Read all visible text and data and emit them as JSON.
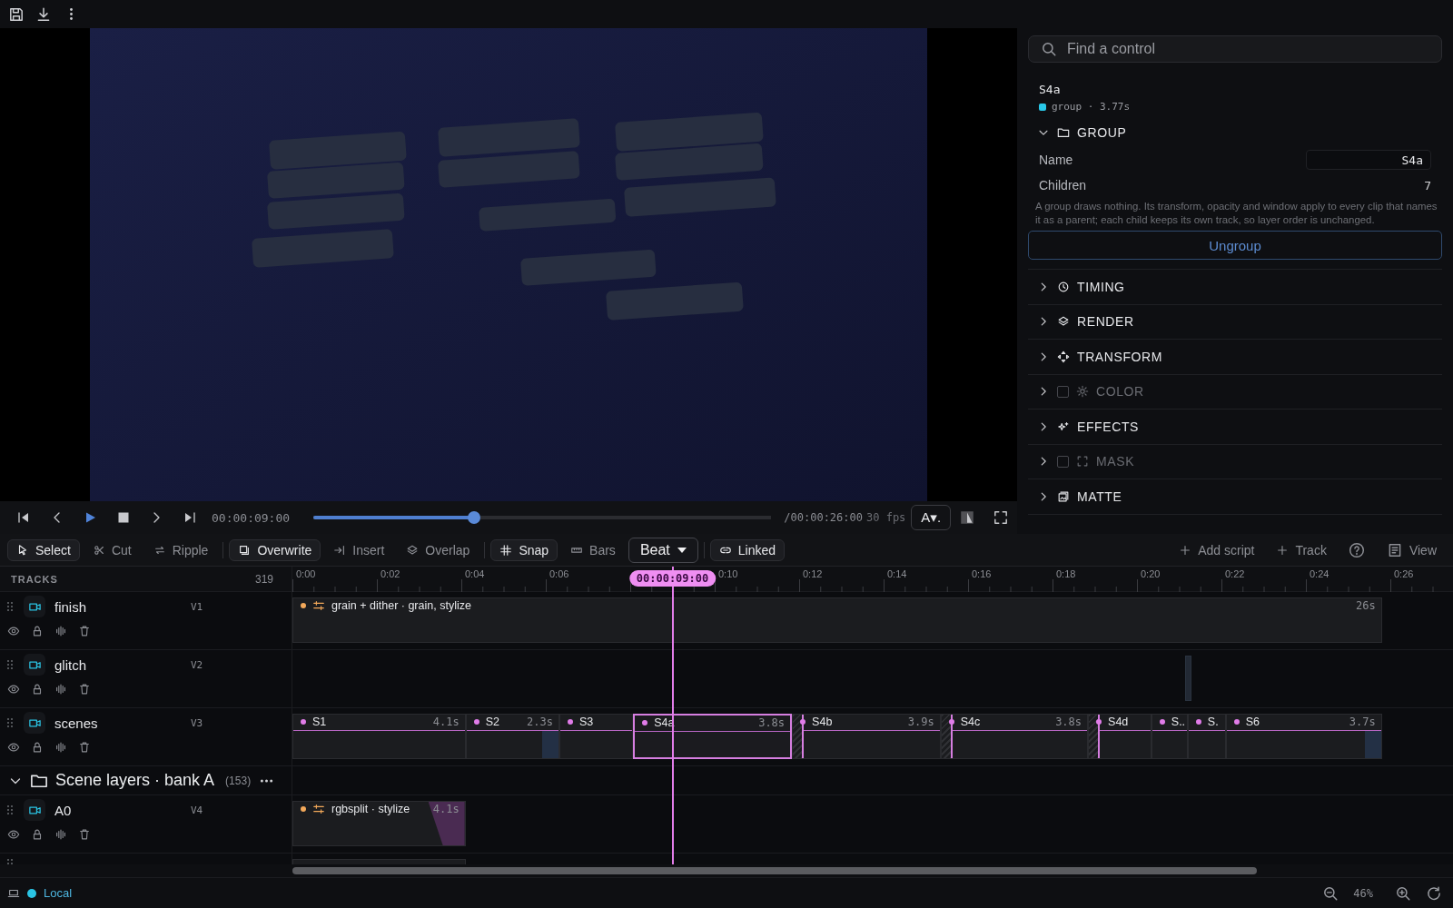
{
  "transport": {
    "timecode": "00:00:09:00",
    "level": 0.35,
    "duration": "/00:00:26:00",
    "fps": "30 fps",
    "aspect": "A▾."
  },
  "inspector": {
    "search_placeholder": "Find a control",
    "title": "S4a",
    "meta": "group · 3.77s",
    "color": "#29c8e8",
    "sections": [
      {
        "title": "GROUP",
        "expanded": true,
        "fields": [
          {
            "kind": "input",
            "label": "Name",
            "value": "S4a"
          },
          {
            "kind": "text",
            "label": "Children",
            "value": "7"
          }
        ],
        "note": "A group draws nothing. Its transform, opacity and window apply to every clip that names it as a parent; each child keeps its own track, so layer order is unchanged.",
        "button": "Ungroup"
      },
      {
        "title": "TIMING",
        "expanded": false
      },
      {
        "title": "RENDER",
        "expanded": false
      },
      {
        "title": "TRANSFORM",
        "expanded": false
      },
      {
        "title": "COLOR",
        "expanded": false,
        "enabled": false
      },
      {
        "title": "EFFECTS",
        "expanded": false
      },
      {
        "title": "MASK",
        "expanded": false,
        "enabled": false
      },
      {
        "title": "MATTE",
        "expanded": false
      }
    ]
  },
  "edit_tools": [
    {
      "label": "Select",
      "selected": true
    },
    {
      "label": "Cut",
      "selected": false
    },
    {
      "label": "Ripple",
      "selected": false
    }
  ],
  "modes": [
    {
      "label": "Overwrite",
      "selected": true
    },
    {
      "label": "Insert",
      "selected": false
    },
    {
      "label": "Overlap",
      "selected": false
    }
  ],
  "grid": [
    {
      "label": "Snap",
      "selected": true
    },
    {
      "label": "Bars",
      "selected": false
    }
  ],
  "grid_unit": "Beat",
  "linked": {
    "label": "Linked",
    "selected": true
  },
  "actions": [
    "Add script",
    "Track"
  ],
  "view": "View",
  "tracks_header": {
    "title": "TRACKS",
    "count": "319"
  },
  "ruler_before_playhead": [
    "0:00",
    "0:02",
    "0:04",
    "0:06"
  ],
  "ruler_after_playhead": [
    "0:10",
    "0:12",
    "0:14",
    "0:16",
    "0:18",
    "0:20",
    "0:22",
    "0:24",
    "0:26"
  ],
  "playhead": "00:00:09:00",
  "tracks": [
    {
      "kind": "track",
      "name": "finish",
      "id": "V1",
      "clips": [
        {
          "kind": "effect",
          "label": "grain + dither · grain, stylize",
          "duration": "26s",
          "selected": false
        }
      ]
    },
    {
      "kind": "track",
      "name": "glitch",
      "id": "V2",
      "clips": [
        {
          "kind": "blank",
          "selected": false
        }
      ]
    },
    {
      "kind": "track",
      "name": "scenes",
      "id": "V3",
      "clips": [
        {
          "kind": "scene",
          "label": "S1",
          "duration": "4.1s",
          "selected": false
        },
        {
          "kind": "scene",
          "label": "S2",
          "duration": "2.3s",
          "selected": false,
          "fade_out": true
        },
        {
          "kind": "scene",
          "label": "S3",
          "selected": false
        },
        {
          "kind": "scene",
          "label": "S4a",
          "duration": "3.8s",
          "selected": true
        },
        {
          "kind": "scene",
          "label": "S4b",
          "duration": "3.9s",
          "selected": false,
          "transition": true
        },
        {
          "kind": "scene",
          "label": "S4c",
          "duration": "3.8s",
          "selected": false,
          "transition": true
        },
        {
          "kind": "scene",
          "label": "S4d",
          "selected": false,
          "transition": true
        },
        {
          "kind": "scene",
          "label": "S..",
          "selected": false
        },
        {
          "kind": "scene",
          "label": "S.",
          "selected": false
        },
        {
          "kind": "scene",
          "label": "S6",
          "duration": "3.7s",
          "selected": false,
          "fade_out": true
        }
      ]
    },
    {
      "kind": "group",
      "name": "Scene layers · bank A",
      "count": "(153)",
      "expanded": true
    },
    {
      "kind": "track",
      "name": "A0",
      "id": "V4",
      "clips": [
        {
          "kind": "effect",
          "label": "rgbsplit · stylize",
          "duration": "4.1s",
          "selected": false,
          "fade_out": true
        }
      ]
    },
    {
      "kind": "cut_off"
    }
  ],
  "status": {
    "connection": "Local",
    "zoom": "46%"
  }
}
